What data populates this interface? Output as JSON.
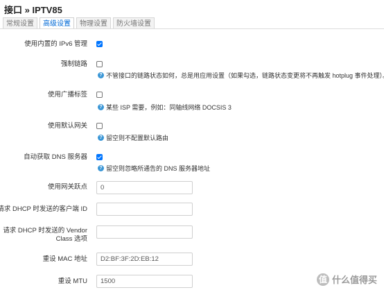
{
  "header": {
    "title": "接口 » IPTV85"
  },
  "tabs": [
    {
      "label": "常规设置",
      "active": false
    },
    {
      "label": "高级设置",
      "active": true
    },
    {
      "label": "物理设置",
      "active": false
    },
    {
      "label": "防火墙设置",
      "active": false
    }
  ],
  "fields": {
    "ipv6": {
      "label": "使用内置的 IPv6 管理",
      "checked": true
    },
    "force_link": {
      "label": "强制链路",
      "checked": false,
      "help": "不管接口的链路状态如何，总是用应用设置（如果勾选，链路状态变更将不再触发 hotplug 事件处理）。"
    },
    "broadcast": {
      "label": "使用广播标签",
      "checked": false,
      "help": "某些 ISP 需要，例如：同轴线网络 DOCSIS 3"
    },
    "default_gw": {
      "label": "使用默认网关",
      "checked": false,
      "help": "留空则不配置默认路由"
    },
    "auto_dns": {
      "label": "自动获取 DNS 服务器",
      "checked": true,
      "help": "留空则忽略所通告的 DNS 服务器地址"
    },
    "metric": {
      "label": "使用网关跃点",
      "value": "0"
    },
    "client_id": {
      "label": "请求 DHCP 时发送的客户端 ID",
      "value": ""
    },
    "vendor_class": {
      "label": "请求 DHCP 时发送的 Vendor Class 选项",
      "value": ""
    },
    "mac": {
      "label": "重设 MAC 地址",
      "value": "D2:BF:3F:2D:EB:12"
    },
    "mtu": {
      "label": "重设 MTU",
      "value": "1500"
    }
  },
  "icons": {
    "help": "question-circle-icon",
    "check": "checkmark-icon"
  },
  "watermark": {
    "badge": "值",
    "text": "什么值得买"
  },
  "colors": {
    "accent": "#0075ff",
    "tab_active": "#0069d6",
    "help": "#3a96d6"
  }
}
